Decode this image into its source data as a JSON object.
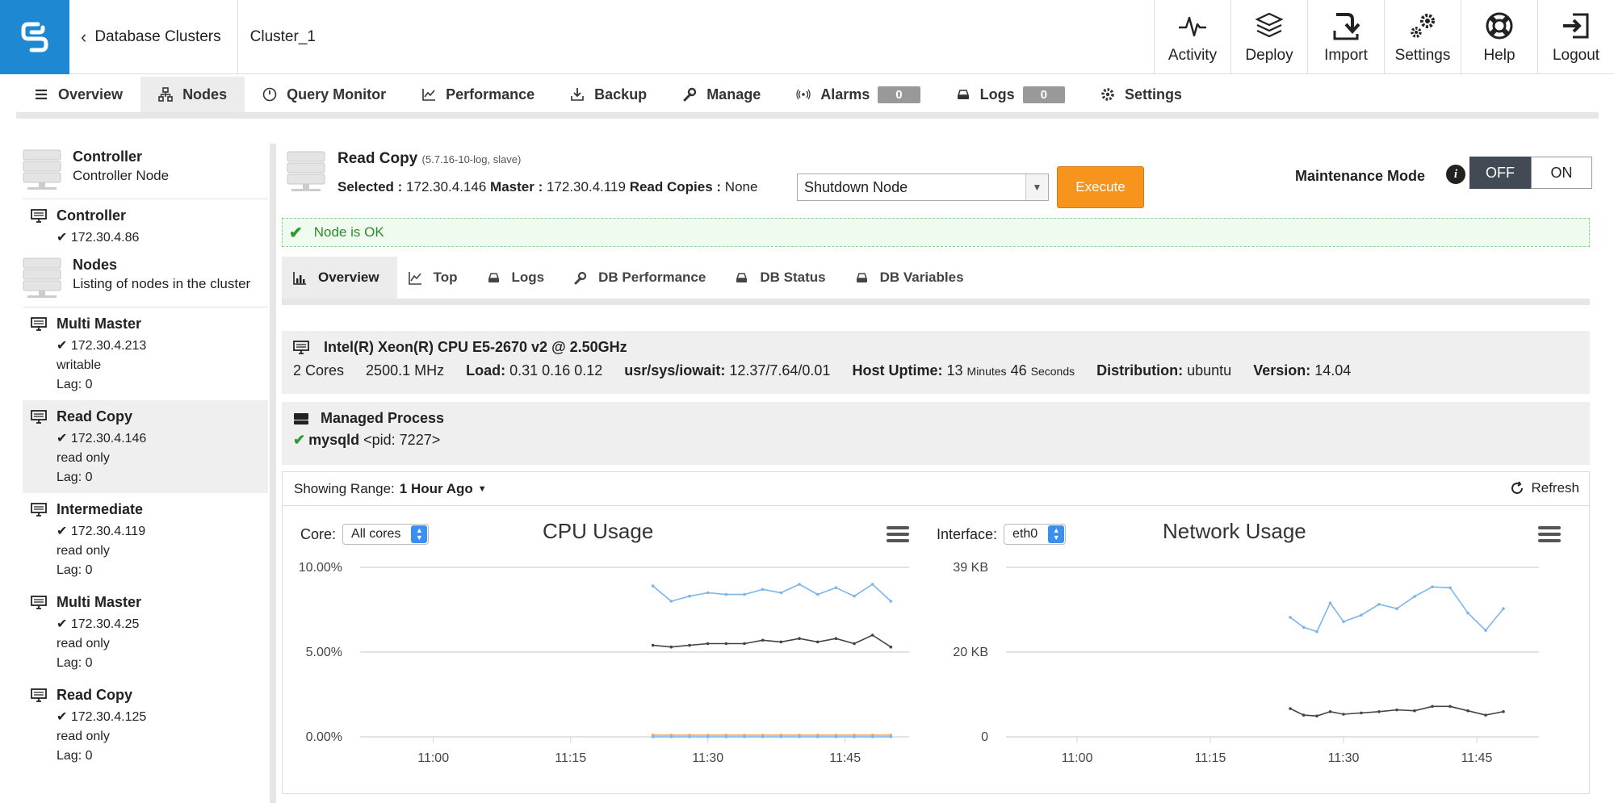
{
  "breadcrumb": {
    "back_label": "Database Clusters",
    "cluster": "Cluster_1"
  },
  "topnav": [
    {
      "label": "Activity",
      "icon": "activity-icon"
    },
    {
      "label": "Deploy",
      "icon": "deploy-icon"
    },
    {
      "label": "Import",
      "icon": "import-icon"
    },
    {
      "label": "Settings",
      "icon": "settings-gears-icon"
    },
    {
      "label": "Help",
      "icon": "lifebuoy-icon"
    },
    {
      "label": "Logout",
      "icon": "logout-icon"
    }
  ],
  "maintabs": [
    {
      "label": "Overview",
      "icon": "list-icon"
    },
    {
      "label": "Nodes",
      "icon": "nodes-icon",
      "active": true
    },
    {
      "label": "Query Monitor",
      "icon": "gauge-icon"
    },
    {
      "label": "Performance",
      "icon": "line-chart-icon"
    },
    {
      "label": "Backup",
      "icon": "download-icon"
    },
    {
      "label": "Manage",
      "icon": "wrench-icon"
    },
    {
      "label": "Alarms",
      "icon": "broadcast-icon",
      "badge": "0"
    },
    {
      "label": "Logs",
      "icon": "disk-icon",
      "badge": "0"
    },
    {
      "label": "Settings",
      "icon": "gear-icon"
    }
  ],
  "sidebar": {
    "controller_group": {
      "title": "Controller",
      "subtitle": "Controller Node"
    },
    "controller_node": {
      "title": "Controller",
      "ip": "172.30.4.86"
    },
    "nodes_group": {
      "title": "Nodes",
      "subtitle": "Listing of nodes in the cluster"
    },
    "nodes": [
      {
        "title": "Multi Master",
        "ip": "172.30.4.213",
        "mode": "writable",
        "lag": "Lag: 0"
      },
      {
        "title": "Read Copy",
        "ip": "172.30.4.146",
        "mode": "read only",
        "lag": "Lag: 0",
        "active": true
      },
      {
        "title": "Intermediate",
        "ip": "172.30.4.119",
        "mode": "read only",
        "lag": "Lag: 0"
      },
      {
        "title": "Multi Master",
        "ip": "172.30.4.25",
        "mode": "read only",
        "lag": "Lag: 0"
      },
      {
        "title": "Read Copy",
        "ip": "172.30.4.125",
        "mode": "read only",
        "lag": "Lag: 0"
      }
    ]
  },
  "node": {
    "title": "Read Copy",
    "version": "(5.7.16-10-log, slave)",
    "selected_label": "Selected :",
    "selected": "172.30.4.146",
    "master_label": "Master :",
    "master": "172.30.4.119",
    "readcopies_label": "Read Copies :",
    "readcopies": "None",
    "action": "Shutdown Node",
    "execute_label": "Execute",
    "maintenance_label": "Maintenance Mode",
    "maint_off": "OFF",
    "maint_on": "ON",
    "status": "Node is OK"
  },
  "subtabs": [
    {
      "label": "Overview",
      "icon": "bar-chart-icon",
      "active": true
    },
    {
      "label": "Top",
      "icon": "line-chart-icon"
    },
    {
      "label": "Logs",
      "icon": "disk-icon"
    },
    {
      "label": "DB Performance",
      "icon": "wrench-icon"
    },
    {
      "label": "DB Status",
      "icon": "disk-icon"
    },
    {
      "label": "DB Variables",
      "icon": "disk-icon"
    }
  ],
  "host": {
    "cpu": "Intel(R) Xeon(R) CPU E5-2670 v2 @ 2.50GHz",
    "cores": "2 Cores",
    "mhz": "2500.1 MHz",
    "load_label": "Load:",
    "load": "0.31 0.16 0.12",
    "iowait_label": "usr/sys/iowait:",
    "iowait": "12.37/7.64/0.01",
    "uptime_label": "Host Uptime:",
    "uptime_min": "13",
    "minutes": "Minutes",
    "uptime_sec": "46",
    "seconds": "Seconds",
    "dist_label": "Distribution:",
    "dist": "ubuntu",
    "version_label": "Version:",
    "version": "14.04"
  },
  "process": {
    "title": "Managed Process",
    "name": "mysqld",
    "pid": "<pid: 7227>"
  },
  "charts": {
    "range_label": "Showing Range:",
    "range_value": "1 Hour Ago",
    "refresh_label": "Refresh",
    "cpu": {
      "control_label": "Core:",
      "control_value": "All cores",
      "title": "CPU Usage"
    },
    "net": {
      "control_label": "Interface:",
      "control_value": "eth0",
      "title": "Network Usage"
    }
  },
  "colors": {
    "brand": "#1e88d3",
    "execute": "#f7941d",
    "line_blue": "#7cb5ec",
    "line_dark": "#434348",
    "line_orange": "#f7a35c"
  },
  "chart_data": [
    {
      "type": "line",
      "title": "CPU Usage",
      "x_ticks": [
        "11:00",
        "11:15",
        "11:30",
        "11:45"
      ],
      "y_ticks": [
        "0.00%",
        "5.00%",
        "10.00%"
      ],
      "ylim": [
        0,
        10
      ],
      "x": [
        24,
        26,
        28,
        30,
        32,
        34,
        36,
        38,
        40,
        42,
        44,
        46,
        48,
        50
      ],
      "series": [
        {
          "color": "#7cb5ec",
          "values": [
            8.9,
            8.0,
            8.3,
            8.5,
            8.4,
            8.4,
            8.7,
            8.5,
            9.0,
            8.4,
            8.8,
            8.3,
            9.0,
            8.0
          ]
        },
        {
          "color": "#434348",
          "values": [
            5.4,
            5.3,
            5.4,
            5.5,
            5.5,
            5.5,
            5.7,
            5.6,
            5.8,
            5.6,
            5.8,
            5.5,
            6.0,
            5.3
          ]
        },
        {
          "color": "#f7a35c",
          "values": [
            0.1,
            0.1,
            0.1,
            0.1,
            0.1,
            0.1,
            0.1,
            0.1,
            0.1,
            0.1,
            0.1,
            0.1,
            0.1,
            0.1
          ]
        },
        {
          "color": "#7cb5ec",
          "values": [
            0.0,
            0.0,
            0.0,
            0.0,
            0.0,
            0.0,
            0.0,
            0.0,
            0.0,
            0.0,
            0.0,
            0.0,
            0.0,
            0.0
          ]
        }
      ]
    },
    {
      "type": "line",
      "title": "Network Usage",
      "x_ticks": [
        "11:00",
        "11:15",
        "11:30",
        "11:45"
      ],
      "y_ticks": [
        "0",
        "20 KB",
        "39 KB"
      ],
      "ylim": [
        0,
        39
      ],
      "x": [
        24,
        25.5,
        27,
        28.5,
        30,
        32,
        34,
        36,
        38,
        40,
        42,
        44,
        46,
        48,
        50
      ],
      "series": [
        {
          "color": "#7cb5ec",
          "values": [
            27.5,
            25.2,
            24.2,
            30.8,
            26.5,
            28.0,
            30.5,
            29.5,
            32.3,
            34.5,
            34.3,
            28.5,
            24.5,
            29.5
          ]
        },
        {
          "color": "#434348",
          "values": [
            6.5,
            5.0,
            4.8,
            5.8,
            5.2,
            5.5,
            5.8,
            6.2,
            6.0,
            7.0,
            7.0,
            6.0,
            5.0,
            5.8
          ]
        }
      ]
    }
  ]
}
